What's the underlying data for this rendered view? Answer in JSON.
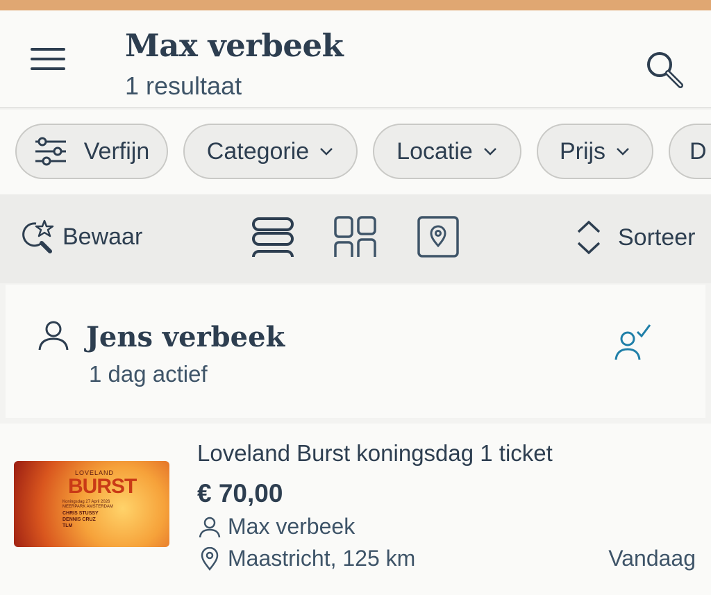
{
  "header": {
    "title": "Max verbeek",
    "subtitle": "1 resultaat"
  },
  "filters": {
    "refine_label": "Verfijn",
    "category_label": "Categorie",
    "location_label": "Locatie",
    "price_label": "Prijs",
    "partial_label": "D"
  },
  "toolbar": {
    "save_label": "Bewaar",
    "sort_label": "Sorteer"
  },
  "profile": {
    "name": "Jens verbeek",
    "activity": "1 dag actief"
  },
  "listing": {
    "title": "Loveland Burst koningsdag 1 ticket",
    "price": "€ 70,00",
    "seller": "Max verbeek",
    "location": "Maastricht, 125 km",
    "date": "Vandaag",
    "image": {
      "brand": "LOVELAND",
      "headline": "BURST",
      "lines": [
        "Koningsdag 27 April 2026",
        "MEERPARK AMSTERDAM",
        "CHRIS STUSSY",
        "DENNIS CRUZ",
        "TLM"
      ]
    }
  },
  "colors": {
    "accent_bar": "#e0a772",
    "text_primary": "#2d3e50",
    "follow_icon": "#1f7fa8"
  }
}
